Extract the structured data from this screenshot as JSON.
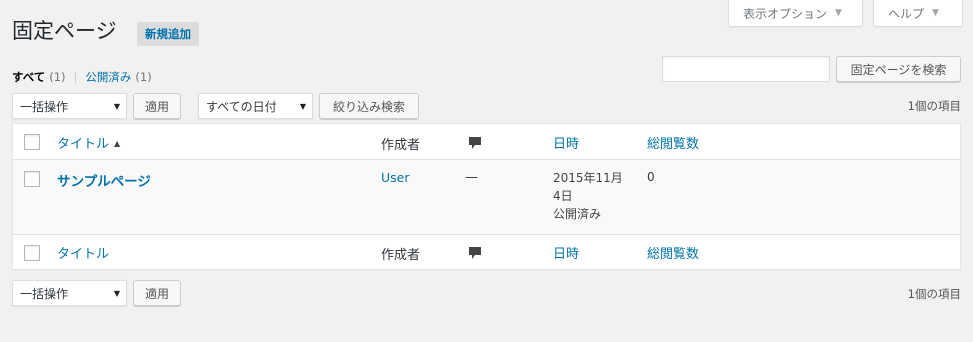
{
  "screen_meta": {
    "options_label": "表示オプション",
    "help_label": "ヘルプ"
  },
  "header": {
    "title": "固定ページ",
    "add_new_label": "新規追加"
  },
  "views": {
    "all_label": "すべて",
    "all_count": "(1)",
    "separator": "|",
    "published_label": "公開済み",
    "published_count": "(1)"
  },
  "search": {
    "value": "",
    "button_label": "固定ページを検索"
  },
  "tablenav_top": {
    "bulk_action_selected": "一括操作",
    "apply_label": "適用",
    "date_filter_selected": "すべての日付",
    "filter_button_label": "絞り込み検索",
    "items_count": "1個の項目"
  },
  "table": {
    "columns": {
      "title": "タイトル",
      "author": "作成者",
      "date": "日時",
      "views": "総閲覧数"
    },
    "sort_indicator": "▲",
    "rows": [
      {
        "title": "サンプルページ",
        "author": "User",
        "comments": "—",
        "date_line1": "2015年11月",
        "date_line2": "4日",
        "status": "公開済み",
        "views": "0"
      }
    ]
  },
  "tablenav_bottom": {
    "bulk_action_selected": "一括操作",
    "apply_label": "適用",
    "items_count": "1個の項目"
  },
  "colors": {
    "background": "#f1f1f1",
    "link": "#0073aa",
    "border": "#e5e5e5"
  }
}
